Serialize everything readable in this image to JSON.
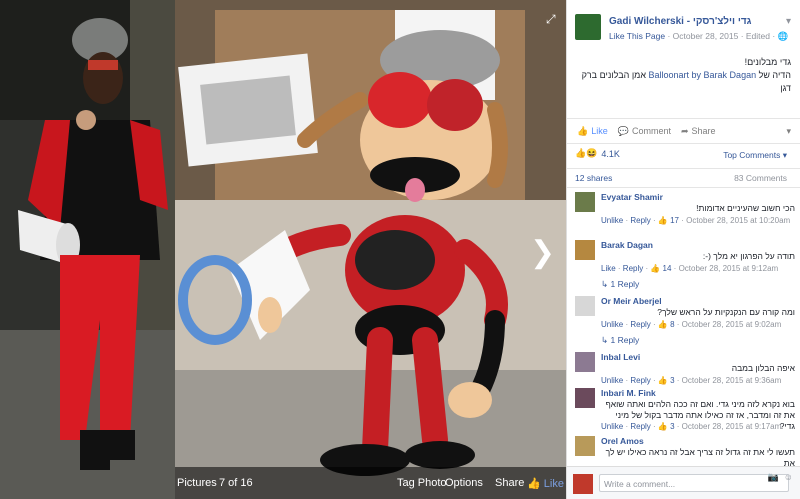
{
  "viewer": {
    "album_label": "Pictures",
    "counter": "7 of 16",
    "tag_photo": "Tag Photo",
    "options": "Options",
    "share": "Share",
    "like": "Like"
  },
  "post": {
    "page_name": "Gadi Wilcherski - גדי וילצ'רסקי",
    "like_page": "Like This Page",
    "date": "October 28, 2015",
    "edited": "Edited",
    "text_line1": "גדי מבלונים!",
    "text_line2_prefix": "הדיה של ",
    "text_link": "Balloonart by Barak Dagan",
    "text_line2_suffix": " אמן הבלונים ברק דגן"
  },
  "actions": {
    "like": "Like",
    "comment": "Comment",
    "share": "Share"
  },
  "stats": {
    "reactions": "4.1K",
    "top_comments": "Top Comments",
    "shares": "12 shares",
    "comments": "83 Comments"
  },
  "comments": [
    {
      "name": "Evyatar Shamir",
      "text": "הכי חשוב שהעיניים אדומות!",
      "unlike": "Unlike",
      "reply": "Reply",
      "likes": "17",
      "time": "October 28, 2015 at 10:20am"
    },
    {
      "name": "Barak Dagan",
      "text": "תודה על הפרגון יא מלך (-:",
      "unlike": "Like",
      "reply": "Reply",
      "likes": "14",
      "time": "October 28, 2015 at 9:12am",
      "replies": "1 Reply"
    },
    {
      "name": "Or Meir Aberjel",
      "text": "ומה קורה עם הנקנקיות על הראש שלך?",
      "unlike": "Unlike",
      "reply": "Reply",
      "likes": "8",
      "time": "October 28, 2015 at 9:02am",
      "replies": "1 Reply"
    },
    {
      "name": "Inbal Levi",
      "text": "איפה הבלון במבה",
      "unlike": "Unlike",
      "reply": "Reply",
      "likes": "3",
      "time": "October 28, 2015 at 9:36am"
    },
    {
      "name": "Inbari M. Fink",
      "text": "בוא נקרא לזה מיני גדי. ואם זה ככה הלהים ואתה שואף את זה ומדבר, אז זה כאילו אתה מדבר בקול של מיני גדי?",
      "unlike": "Unlike",
      "reply": "Reply",
      "likes": "3",
      "time": "October 28, 2015 at 9:17am"
    },
    {
      "name": "Orel Amos",
      "text": "תעשו לי את זה גדול זה צריך אבל זה נראה כאילו יש לך את"
    }
  ],
  "write_placeholder": "Write a comment..."
}
